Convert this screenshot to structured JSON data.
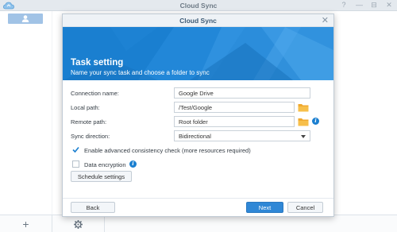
{
  "app": {
    "title": "Cloud Sync",
    "window_controls": [
      "?",
      "—",
      "⊟",
      "✕"
    ]
  },
  "sidebar": {
    "account_icon": "user-icon",
    "add_label": "+",
    "settings_icon": "gear-icon"
  },
  "dialog": {
    "title": "Cloud Sync",
    "close_label": "✕",
    "banner_title": "Task setting",
    "banner_subtitle": "Name your sync task and choose a folder to sync",
    "fields": {
      "connection_name": {
        "label": "Connection name:",
        "value": "Google Drive"
      },
      "local_path": {
        "label": "Local path:",
        "value": "/Test/Google"
      },
      "remote_path": {
        "label": "Remote path:",
        "value": "Root folder"
      },
      "sync_direction": {
        "label": "Sync direction:",
        "value": "Bidirectional"
      }
    },
    "checks": {
      "consistency": {
        "label": "Enable advanced consistency check (more resources required)",
        "checked": true
      },
      "encryption": {
        "label": "Data encryption",
        "checked": false
      }
    },
    "schedule_button": "Schedule settings",
    "back_button": "Back",
    "next_button": "Next",
    "cancel_button": "Cancel"
  },
  "colors": {
    "accent": "#1a7fd0",
    "folder": "#f0a92e",
    "primary_button": "#2f87d6"
  }
}
